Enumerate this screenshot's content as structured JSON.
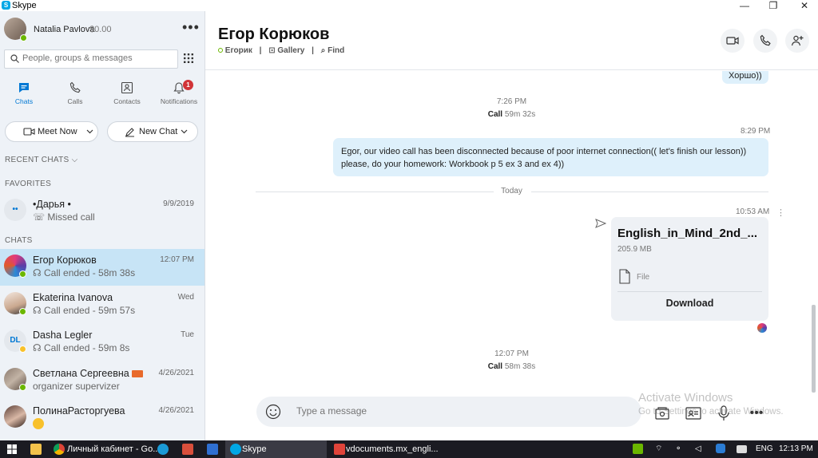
{
  "app": {
    "title": "Skype",
    "logo_letter": "S"
  },
  "window_controls": {
    "minimize": "—",
    "maximize": "❐",
    "close": "✕"
  },
  "profile": {
    "name": "Natalia Pavlova",
    "credit": "$0.00",
    "more": "•••"
  },
  "search": {
    "placeholder": "People, groups & messages"
  },
  "nav": {
    "tabs": [
      {
        "label": "Chats"
      },
      {
        "label": "Calls"
      },
      {
        "label": "Contacts"
      },
      {
        "label": "Notifications",
        "badge": "1"
      }
    ]
  },
  "actions": {
    "meet_now": "Meet Now",
    "new_chat": "New Chat"
  },
  "sections": {
    "recent": "RECENT CHATS",
    "favorites": "FAVORITES",
    "chats": "CHATS"
  },
  "favorites": [
    {
      "name": "•Дарья •",
      "sub": "Missed call",
      "time": "9/9/2019",
      "avatar_text": "••"
    }
  ],
  "chats": [
    {
      "name": "Егор Корюков",
      "sub": "Call ended - 58m 38s",
      "time": "12:07 PM"
    },
    {
      "name": "Ekaterina Ivanova",
      "sub": "Call ended - 59m 57s",
      "time": "Wed"
    },
    {
      "name": "Dasha Legler",
      "sub": "Call ended - 59m 8s",
      "time": "Tue",
      "avatar_text": "DL"
    },
    {
      "name": "Светлана Сергеевна",
      "sub": "organizer supervizer",
      "time": "4/26/2021"
    },
    {
      "name": "ПолинаРасторгуева",
      "sub": "",
      "time": "4/26/2021"
    }
  ],
  "conversation": {
    "title": "Егор Корюков",
    "sub_name": "Егорик",
    "gallery": "Gallery",
    "find": "Find",
    "sep": "|"
  },
  "messages": {
    "top_bubble": "Хоршо))",
    "call1_time": "7:26 PM",
    "call1_label": "Call",
    "call1_duration": "59m 32s",
    "msg_time": "8:29 PM",
    "msg_text_line1": "Egor, our video call has been disconnected because of poor internet connection(( let's finish our lesson))",
    "msg_text_line2": "please, do your homework: Workbook p 5 ex 3 and ex 4))",
    "divider": "Today",
    "file_time": "10:53 AM",
    "file_name": "English_in_Mind_2nd_...",
    "file_size": "205.9 MB",
    "file_type": "File",
    "download": "Download",
    "call2_time": "12:07 PM",
    "call2_label": "Call",
    "call2_duration": "58m 38s"
  },
  "composer": {
    "placeholder": "Type a message"
  },
  "watermark": {
    "line1": "Activate Windows",
    "line2": "Go to Settings to activate Windows."
  },
  "taskbar": {
    "chrome": "Личный кабинет - Go...",
    "skype": "Skype",
    "pdf": "vdocuments.mx_engli...",
    "lang": "ENG",
    "clock": "12:13 PM"
  },
  "colors": {
    "accent": "#0078d4",
    "online": "#6bb700",
    "badge": "#d13438",
    "bubble": "#def0fb",
    "active_chat": "#c7e4f6"
  }
}
